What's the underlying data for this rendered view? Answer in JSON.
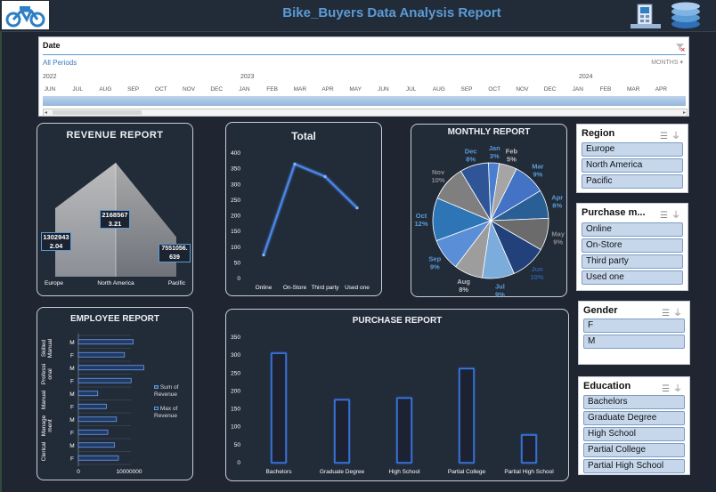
{
  "header": {
    "title": "Bike_Buyers Data Analysis Report"
  },
  "timeline": {
    "header": "Date",
    "period_label": "All Periods",
    "level": "MONTHS ▾",
    "years": [
      "2022",
      "2023",
      "2024"
    ],
    "months": [
      "JUN",
      "JUL",
      "AUG",
      "SEP",
      "OCT",
      "NOV",
      "DEC",
      "JAN",
      "FEB",
      "MAR",
      "APR",
      "MAY",
      "JUN",
      "JUL",
      "AUG",
      "SEP",
      "OCT",
      "NOV",
      "DEC",
      "JAN",
      "FEB",
      "MAR",
      "APR"
    ],
    "scroll_left": "◂",
    "scroll_right": "▸"
  },
  "revenue_report": {
    "title": "REVENUE REPORT",
    "labels": [
      {
        "line1": "1302943",
        "line2": "2.04"
      },
      {
        "line1": "2168567",
        "line2": "3.21"
      },
      {
        "line1": "7551056.",
        "line2": "639"
      }
    ]
  },
  "employee_report": {
    "title": "EMPLOYEE REPORT",
    "legend_sum": "Sum of Revenue",
    "legend_max": "Max of Revenue"
  },
  "slicers": {
    "region": {
      "title": "Region",
      "items": [
        "Europe",
        "North America",
        "Pacific"
      ]
    },
    "purchase": {
      "title": "Purchase m...",
      "items": [
        "Online",
        "On-Store",
        "Third party",
        "Used one"
      ]
    },
    "gender": {
      "title": "Gender",
      "items": [
        "F",
        "M"
      ]
    },
    "education": {
      "title": "Education",
      "items": [
        "Bachelors",
        "Graduate Degree",
        "High School",
        "Partial College",
        "Partial High School"
      ]
    }
  },
  "icons": {
    "logo": "bike-logo-icon",
    "building": "building-icon",
    "database": "database-icon",
    "filter": "clear-filter-icon",
    "multiselect": "multi-select-icon"
  },
  "colors": {
    "background": "#1f2632",
    "title": "#5b9bd5",
    "accent": "#4a86e8",
    "slicer_item": "#c6d7ec"
  },
  "chart_data": [
    {
      "type": "area",
      "title": "REVENUE REPORT",
      "categories": [
        "Europe",
        "North America",
        "Pacific"
      ],
      "series": [
        {
          "values": [
            13029432.04,
            21685673.21,
            7551056.639
          ]
        }
      ]
    },
    {
      "type": "line",
      "title": "Total",
      "categories": [
        "Online",
        "On-Store",
        "Third party",
        "Used one"
      ],
      "values": [
        75,
        365,
        325,
        225
      ],
      "ylim": [
        0,
        400
      ],
      "yticks": [
        0,
        50,
        100,
        150,
        200,
        250,
        300,
        350,
        400
      ]
    },
    {
      "type": "pie",
      "title": "MONTHLY REPORT",
      "categories": [
        "Jan",
        "Feb",
        "Mar",
        "Apr",
        "May",
        "Jun",
        "Jul",
        "Aug",
        "Sep",
        "Oct",
        "Nov",
        "Dec"
      ],
      "values": [
        3,
        5,
        9,
        8,
        9,
        10,
        9,
        8,
        9,
        12,
        10,
        8
      ],
      "value_labels": [
        "3%",
        "5%",
        "9%",
        "8%",
        "9%",
        "10%",
        "9%",
        "8%",
        "9%",
        "12%",
        "10%",
        "8%"
      ],
      "colors": [
        "#4a7fd0",
        "#a5a5a5",
        "#4472c4",
        "#2a5f96",
        "#6b6b6b",
        "#22407a",
        "#7cacdc",
        "#9d9d9d",
        "#5a8ed6",
        "#2e75b6",
        "#7f7f7f",
        "#2f5597"
      ]
    },
    {
      "type": "bar",
      "title": "EMPLOYEE REPORT",
      "orientation": "horizontal",
      "groups": [
        "Skilled Manual",
        "Professional",
        "Manual",
        "Management",
        "Clerical"
      ],
      "group_labels": [
        "Skilled\nManual",
        "Professi\nonal",
        "Manual",
        "Manage\nment",
        "Clerical"
      ],
      "categories": [
        "M",
        "F",
        "M",
        "F",
        "M",
        "F",
        "M",
        "F",
        "M",
        "F"
      ],
      "series": [
        {
          "name": "Sum of Revenue",
          "values": [
            8200000,
            6900000,
            9800000,
            7900000,
            2900000,
            4200000,
            5700000,
            4400000,
            5400000,
            6000000
          ]
        }
      ],
      "xticks": [
        "0",
        "10000000"
      ],
      "xlim": [
        0,
        14000000
      ]
    },
    {
      "type": "bar",
      "title": "PURCHASE REPORT",
      "categories": [
        "Bachelors",
        "Graduate Degree",
        "High School",
        "Partial College",
        "Partial High School"
      ],
      "values": [
        305,
        175,
        180,
        262,
        77
      ],
      "ylim": [
        0,
        350
      ],
      "yticks": [
        0,
        50,
        100,
        150,
        200,
        250,
        300,
        350
      ]
    }
  ]
}
